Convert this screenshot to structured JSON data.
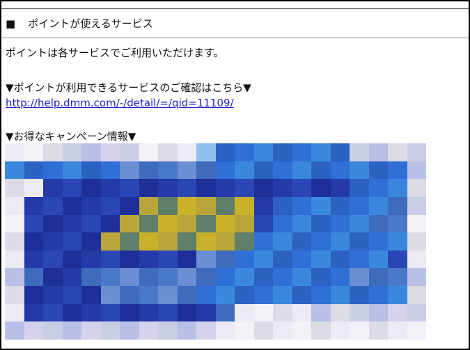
{
  "section": {
    "square": "■",
    "title": "ポイントが使えるサービス"
  },
  "body": {
    "line1": "ポイントは各サービスでご利用いただけます。",
    "confirm_heading": "▼ポイントが利用できるサービスのご確認はこちら▼",
    "help_link": "http://help.dmm.com/-/detail/=/qid=11109/",
    "campaign_heading": "▼お得なキャンペーン情報▼"
  },
  "banner": {
    "description": "pixelated campaign banner image",
    "palette": [
      "#1f2f9a",
      "#2f55c8",
      "#3a88dd",
      "#c9b22a",
      "#e6e6ee",
      "#8fb3e8"
    ]
  }
}
